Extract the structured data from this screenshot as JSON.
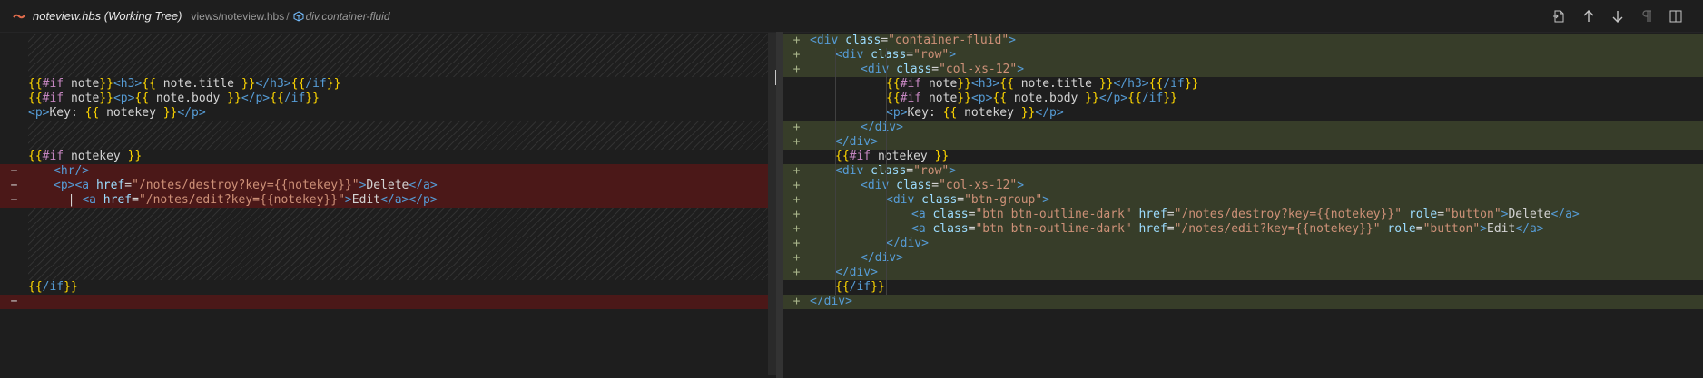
{
  "titlebar": {
    "file_name": "noteview.hbs (Working Tree)",
    "path": "views/noteview.hbs",
    "separator": "/",
    "symbol": "div.container-fluid",
    "accent": "#e06c4c"
  },
  "actions": [
    {
      "name": "open-file-icon"
    },
    {
      "name": "previous-change-icon"
    },
    {
      "name": "next-change-icon"
    },
    {
      "name": "toggle-whitespace-icon"
    },
    {
      "name": "split-editor-icon"
    }
  ],
  "colors": {
    "deleted": "#4b1818",
    "inserted": "#373d29",
    "tag": "#569cd6",
    "attribute": "#9cdcfe",
    "string": "#ce9178",
    "handlebars": "#ffd700"
  },
  "left": {
    "lines": [
      {
        "type": "hatch"
      },
      {
        "type": "hatch"
      },
      {
        "type": "hatch"
      },
      {
        "type": "normal",
        "indent": 0,
        "tokens": [
          [
            "h",
            "{{"
          ],
          [
            "k",
            "#if "
          ],
          [
            "d",
            "note"
          ],
          [
            "h",
            "}}"
          ],
          [
            "t",
            "<h3>"
          ],
          [
            "h",
            "{{"
          ],
          [
            "d",
            " note.title "
          ],
          [
            "h",
            "}}"
          ],
          [
            "t",
            "</h3>"
          ],
          [
            "h",
            "{{"
          ],
          [
            "t",
            "/if"
          ],
          [
            "h",
            "}}"
          ]
        ]
      },
      {
        "type": "normal",
        "indent": 0,
        "tokens": [
          [
            "h",
            "{{"
          ],
          [
            "k",
            "#if "
          ],
          [
            "d",
            "note"
          ],
          [
            "h",
            "}}"
          ],
          [
            "t",
            "<p>"
          ],
          [
            "h",
            "{{"
          ],
          [
            "d",
            " note.body "
          ],
          [
            "h",
            "}}"
          ],
          [
            "t",
            "</p>"
          ],
          [
            "h",
            "{{"
          ],
          [
            "t",
            "/if"
          ],
          [
            "h",
            "}}"
          ]
        ]
      },
      {
        "type": "normal",
        "indent": 0,
        "tokens": [
          [
            "t",
            "<p>"
          ],
          [
            "d",
            "Key: "
          ],
          [
            "h",
            "{{"
          ],
          [
            "d",
            " notekey "
          ],
          [
            "h",
            "}}"
          ],
          [
            "t",
            "</p>"
          ]
        ]
      },
      {
        "type": "hatch"
      },
      {
        "type": "hatch"
      },
      {
        "type": "normal",
        "indent": 0,
        "tokens": [
          [
            "h",
            "{{"
          ],
          [
            "k",
            "#if "
          ],
          [
            "d",
            "notekey "
          ],
          [
            "h",
            "}}"
          ]
        ]
      },
      {
        "type": "del",
        "gutter": "−",
        "indent": 1,
        "tokens": [
          [
            "t",
            "<hr/>"
          ]
        ]
      },
      {
        "type": "del",
        "gutter": "−",
        "indent": 1,
        "tokens": [
          [
            "t",
            "<p><a "
          ],
          [
            "a",
            "href"
          ],
          [
            "d",
            "="
          ],
          [
            "s",
            "\"/notes/destroy?key={{notekey}}\""
          ],
          [
            "t",
            ">"
          ],
          [
            "d",
            "Delete"
          ],
          [
            "t",
            "</a>"
          ]
        ]
      },
      {
        "type": "del",
        "gutter": "−",
        "indent": 1,
        "tokens": [
          [
            "d",
            "  | "
          ],
          [
            "t",
            "<a "
          ],
          [
            "a",
            "href"
          ],
          [
            "d",
            "="
          ],
          [
            "s",
            "\"/notes/edit?key={{notekey}}\""
          ],
          [
            "t",
            ">"
          ],
          [
            "d",
            "Edit"
          ],
          [
            "t",
            "</a></p>"
          ]
        ]
      },
      {
        "type": "hatch"
      },
      {
        "type": "hatch"
      },
      {
        "type": "hatch"
      },
      {
        "type": "hatch"
      },
      {
        "type": "hatch"
      },
      {
        "type": "normal",
        "indent": 0,
        "tokens": [
          [
            "h",
            "{{"
          ],
          [
            "t",
            "/if"
          ],
          [
            "h",
            "}}"
          ]
        ]
      },
      {
        "type": "del",
        "gutter": "−",
        "indent": 0,
        "tokens": []
      }
    ]
  },
  "right": {
    "lines": [
      {
        "type": "ins",
        "gutter": "+",
        "indent": 0,
        "tokens": [
          [
            "t",
            "<div "
          ],
          [
            "a",
            "class"
          ],
          [
            "d",
            "="
          ],
          [
            "s",
            "\"container-fluid\""
          ],
          [
            "t",
            ">"
          ]
        ]
      },
      {
        "type": "ins",
        "gutter": "+",
        "indent": 1,
        "tokens": [
          [
            "t",
            "<div "
          ],
          [
            "a",
            "class"
          ],
          [
            "d",
            "="
          ],
          [
            "s",
            "\"row\""
          ],
          [
            "t",
            ">"
          ]
        ]
      },
      {
        "type": "ins",
        "gutter": "+",
        "indent": 2,
        "tokens": [
          [
            "t",
            "<div "
          ],
          [
            "a",
            "class"
          ],
          [
            "d",
            "="
          ],
          [
            "s",
            "\"col-xs-12\""
          ],
          [
            "t",
            ">"
          ]
        ]
      },
      {
        "type": "normal",
        "indent": 3,
        "tokens": [
          [
            "h",
            "{{"
          ],
          [
            "k",
            "#if "
          ],
          [
            "d",
            "note"
          ],
          [
            "h",
            "}}"
          ],
          [
            "t",
            "<h3>"
          ],
          [
            "h",
            "{{"
          ],
          [
            "d",
            " note.title "
          ],
          [
            "h",
            "}}"
          ],
          [
            "t",
            "</h3>"
          ],
          [
            "h",
            "{{"
          ],
          [
            "t",
            "/if"
          ],
          [
            "h",
            "}}"
          ]
        ]
      },
      {
        "type": "normal",
        "indent": 3,
        "tokens": [
          [
            "h",
            "{{"
          ],
          [
            "k",
            "#if "
          ],
          [
            "d",
            "note"
          ],
          [
            "h",
            "}}"
          ],
          [
            "t",
            "<p>"
          ],
          [
            "h",
            "{{"
          ],
          [
            "d",
            " note.body "
          ],
          [
            "h",
            "}}"
          ],
          [
            "t",
            "</p>"
          ],
          [
            "h",
            "{{"
          ],
          [
            "t",
            "/if"
          ],
          [
            "h",
            "}}"
          ]
        ]
      },
      {
        "type": "normal",
        "indent": 3,
        "tokens": [
          [
            "t",
            "<p>"
          ],
          [
            "d",
            "Key: "
          ],
          [
            "h",
            "{{"
          ],
          [
            "d",
            " notekey "
          ],
          [
            "h",
            "}}"
          ],
          [
            "t",
            "</p>"
          ]
        ]
      },
      {
        "type": "ins",
        "gutter": "+",
        "indent": 2,
        "tokens": [
          [
            "t",
            "</div>"
          ]
        ]
      },
      {
        "type": "ins",
        "gutter": "+",
        "indent": 1,
        "tokens": [
          [
            "t",
            "</div>"
          ]
        ]
      },
      {
        "type": "normal",
        "indent": 1,
        "tokens": [
          [
            "h",
            "{{"
          ],
          [
            "k",
            "#if "
          ],
          [
            "d",
            "notekey "
          ],
          [
            "h",
            "}}"
          ]
        ]
      },
      {
        "type": "ins",
        "gutter": "+",
        "indent": 1,
        "tokens": [
          [
            "t",
            "<div "
          ],
          [
            "a",
            "class"
          ],
          [
            "d",
            "="
          ],
          [
            "s",
            "\"row\""
          ],
          [
            "t",
            ">"
          ]
        ]
      },
      {
        "type": "ins",
        "gutter": "+",
        "indent": 2,
        "tokens": [
          [
            "t",
            "<div "
          ],
          [
            "a",
            "class"
          ],
          [
            "d",
            "="
          ],
          [
            "s",
            "\"col-xs-12\""
          ],
          [
            "t",
            ">"
          ]
        ]
      },
      {
        "type": "ins",
        "gutter": "+",
        "indent": 3,
        "tokens": [
          [
            "t",
            "<div "
          ],
          [
            "a",
            "class"
          ],
          [
            "d",
            "="
          ],
          [
            "s",
            "\"btn-group\""
          ],
          [
            "t",
            ">"
          ]
        ]
      },
      {
        "type": "ins",
        "gutter": "+",
        "indent": 4,
        "tokens": [
          [
            "t",
            "<a "
          ],
          [
            "a",
            "class"
          ],
          [
            "d",
            "="
          ],
          [
            "s",
            "\"btn btn-outline-dark\""
          ],
          [
            "d",
            " "
          ],
          [
            "a",
            "href"
          ],
          [
            "d",
            "="
          ],
          [
            "s",
            "\"/notes/destroy?key={{notekey}}\""
          ],
          [
            "d",
            " "
          ],
          [
            "a",
            "role"
          ],
          [
            "d",
            "="
          ],
          [
            "s",
            "\"button\""
          ],
          [
            "t",
            ">"
          ],
          [
            "d",
            "Delete"
          ],
          [
            "t",
            "</a>"
          ]
        ]
      },
      {
        "type": "ins",
        "gutter": "+",
        "indent": 4,
        "tokens": [
          [
            "t",
            "<a "
          ],
          [
            "a",
            "class"
          ],
          [
            "d",
            "="
          ],
          [
            "s",
            "\"btn btn-outline-dark\""
          ],
          [
            "d",
            " "
          ],
          [
            "a",
            "href"
          ],
          [
            "d",
            "="
          ],
          [
            "s",
            "\"/notes/edit?key={{notekey}}\""
          ],
          [
            "d",
            " "
          ],
          [
            "a",
            "role"
          ],
          [
            "d",
            "="
          ],
          [
            "s",
            "\"button\""
          ],
          [
            "t",
            ">"
          ],
          [
            "d",
            "Edit"
          ],
          [
            "t",
            "</a>"
          ]
        ]
      },
      {
        "type": "ins",
        "gutter": "+",
        "indent": 3,
        "tokens": [
          [
            "t",
            "</div>"
          ]
        ]
      },
      {
        "type": "ins",
        "gutter": "+",
        "indent": 2,
        "tokens": [
          [
            "t",
            "</div>"
          ]
        ]
      },
      {
        "type": "ins",
        "gutter": "+",
        "indent": 1,
        "tokens": [
          [
            "t",
            "</div>"
          ]
        ]
      },
      {
        "type": "normal",
        "indent": 1,
        "tokens": [
          [
            "h",
            "{{"
          ],
          [
            "t",
            "/if"
          ],
          [
            "h",
            "}}"
          ]
        ]
      },
      {
        "type": "ins",
        "gutter": "+",
        "indent": 0,
        "tokens": [
          [
            "t",
            "</div>"
          ]
        ]
      }
    ]
  }
}
